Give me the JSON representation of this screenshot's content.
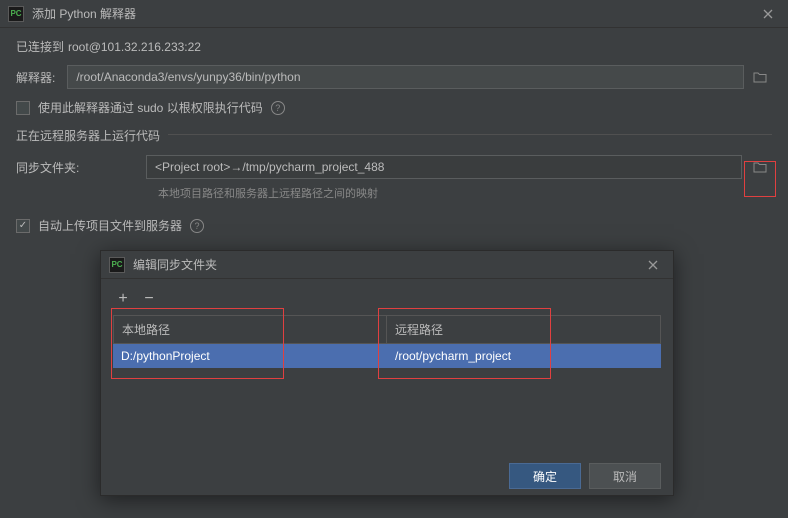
{
  "window": {
    "title": "添加 Python 解释器",
    "icon_text": "PC"
  },
  "connection": {
    "prefix": "已连接到",
    "target": "root@101.32.216.233:22"
  },
  "interpreter": {
    "label": "解释器:",
    "value": "/root/Anaconda3/envs/yunpy36/bin/python"
  },
  "sudo": {
    "label": "使用此解释器通过 sudo 以根权限执行代码"
  },
  "remote": {
    "legend": "正在远程服务器上运行代码",
    "sync_label": "同步文件夹:",
    "sync_value": "<Project root>→/tmp/pycharm_project_488",
    "hint": "本地项目路径和服务器上远程路径之间的映射"
  },
  "auto_upload": {
    "label": "自动上传项目文件到服务器"
  },
  "dialog": {
    "title": "编辑同步文件夹",
    "icon_text": "PC",
    "headers": {
      "local": "本地路径",
      "remote": "远程路径"
    },
    "row": {
      "local": "D:/pythonProject",
      "remote": "/root/pycharm_project"
    },
    "buttons": {
      "ok": "确定",
      "cancel": "取消"
    }
  }
}
